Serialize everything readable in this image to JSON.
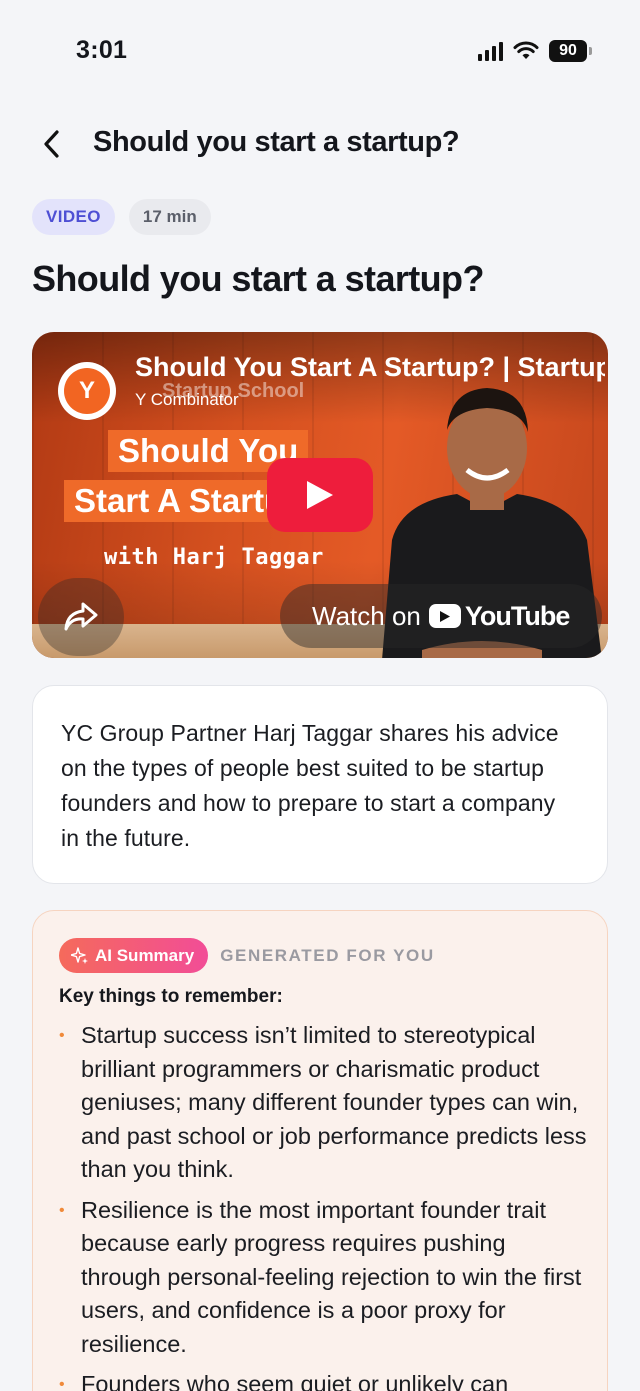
{
  "status": {
    "time": "3:01",
    "battery": "90"
  },
  "header": {
    "title": "Should you start a startup?"
  },
  "tags": {
    "type": "VIDEO",
    "duration": "17 min"
  },
  "page_title": "Should you start a startup?",
  "video": {
    "channel_initial": "Y",
    "title": "Should You Start A Startup? | Startup School",
    "channel": "Y Combinator",
    "channel_ghost": "Startup School",
    "thumb_line_1": "Should You",
    "thumb_line_2": "Start A Startup",
    "thumb_with": "with Harj Taggar",
    "watch_on": "Watch on",
    "youtube": "YouTube"
  },
  "description": "YC Group Partner Harj Taggar shares his advice on the types of people best suited to be startup founders and how to prepare to start a company in the future.",
  "ai_summary": {
    "badge": "AI Summary",
    "generated": "GENERATED FOR YOU",
    "heading": "Key things to remember:",
    "points": [
      "Startup success isn’t limited to stereotypical brilliant programmers or charismatic product geniuses; many different founder types can win, and past school or job performance predicts less than you think.",
      "Resilience is the most important founder trait because early progress requires pushing through personal-feeling rejection to win the first users, and confidence is a poor proxy for resilience.",
      "Founders who seem quiet or unlikely can"
    ]
  },
  "colors": {
    "accent": "#4e4fd4",
    "youtube_red": "#ee1d3c",
    "yc_orange": "#f26522",
    "bullet": "#f08a3a"
  }
}
